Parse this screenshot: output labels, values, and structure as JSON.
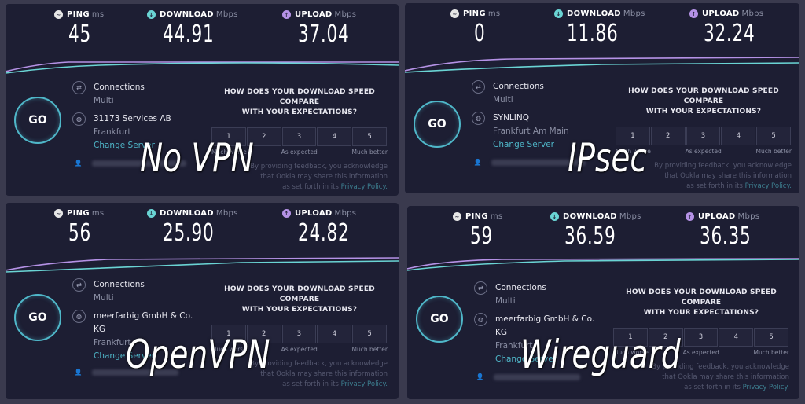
{
  "labels": {
    "ping": "PING",
    "ping_unit": "ms",
    "download": "DOWNLOAD",
    "download_unit": "Mbps",
    "upload": "UPLOAD",
    "upload_unit": "Mbps",
    "go": "GO",
    "connections": "Connections",
    "multi": "Multi",
    "change_server": "Change Server",
    "question_line1": "HOW DOES YOUR DOWNLOAD SPEED COMPARE",
    "question_line2": "WITH YOUR EXPECTATIONS?",
    "ratings": [
      "1",
      "2",
      "3",
      "4",
      "5"
    ],
    "much_worse": "Much worse",
    "as_expected": "As expected",
    "much_better": "Much better",
    "fine_line1": "By providing feedback, you acknowledge",
    "fine_line2": "that Ookla may share this information",
    "fine_line3": "as set forth in its",
    "privacy_policy": "Privacy Policy."
  },
  "icons": {
    "ping": "ping-icon",
    "download": "download-arrow-icon",
    "upload": "upload-arrow-icon",
    "connections": "connections-icon",
    "server": "globe-icon",
    "user": "user-icon"
  },
  "colors": {
    "panel_bg": "#1d1e33",
    "download_line": "#6ad4d4",
    "upload_line": "#b592e6",
    "go_ring": "#4fb7c9"
  },
  "panels": [
    {
      "overlay_label": "No VPN",
      "ping": "45",
      "download": "44.91",
      "upload": "37.04",
      "server_line1": "31173 Services AB",
      "server_line2": "",
      "location": "Frankfurt"
    },
    {
      "overlay_label": "IPsec",
      "ping": "0",
      "download": "11.86",
      "upload": "32.24",
      "server_line1": "SYNLINQ",
      "server_line2": "",
      "location": "Frankfurt Am Main"
    },
    {
      "overlay_label": "OpenVPN",
      "ping": "56",
      "download": "25.90",
      "upload": "24.82",
      "server_line1": "meerfarbig GmbH & Co.",
      "server_line2": "KG",
      "location": "Frankfurt"
    },
    {
      "overlay_label": "Wireguard",
      "ping": "59",
      "download": "36.59",
      "upload": "36.35",
      "server_line1": "meerfarbig GmbH & Co.",
      "server_line2": "KG",
      "location": "Frankfurt"
    }
  ]
}
